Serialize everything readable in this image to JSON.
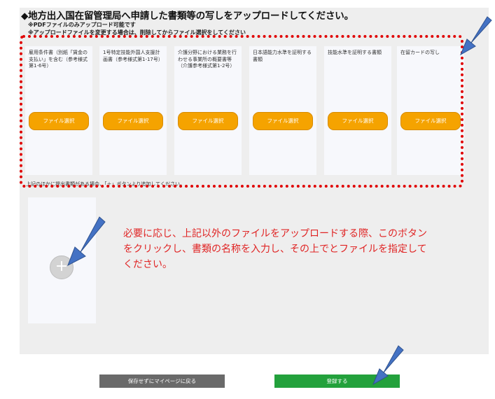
{
  "page": {
    "heading": "◆地方出入国在留管理局へ申請した書類等の写しをアップロードしてください。",
    "note_pdf_only": "※PDFファイルのみアップロード可能です",
    "note_change_file": "※アップロードファイルを変更する場合は、削除してからファイル選択をしてください"
  },
  "documents": [
    {
      "label": "雇用条件書（別紙「賃金の支払い」を含む（参考様式第1-6号）",
      "button": "ファイル選択"
    },
    {
      "label": "1号特定技能外国人支援計画書（参考様式第1-17号）",
      "button": "ファイル選択"
    },
    {
      "label": "介護分野における業務を行わせる事業所の概要書等（介護参考様式第1-2号）",
      "button": "ファイル選択"
    },
    {
      "label": "日本語能力水準を証明する書類",
      "button": "ファイル選択"
    },
    {
      "label": "技能水準を証明する書類",
      "button": "ファイル選択"
    },
    {
      "label": "在留カードの写し",
      "button": "ファイル選択"
    }
  ],
  "footnote": "上記のほかに提出書類がある場合、「＋」ボタンより追加してください。",
  "add_button": {
    "symbol": "+"
  },
  "instruction": "必要に応じ、上記以外のファイルをアップロードする際、このボタンをクリックし、書類の名称を入力し、その上でとファイルを指定してください。",
  "actions": {
    "back_label": "保存せずにマイページに戻る",
    "submit_label": "登録する"
  },
  "colors": {
    "file_button": "#f5a300",
    "highlight_border": "#e00000",
    "instruction_text": "#e02424",
    "submit": "#23a13c",
    "back": "#6a6a6a",
    "arrow": "#4472c4"
  }
}
